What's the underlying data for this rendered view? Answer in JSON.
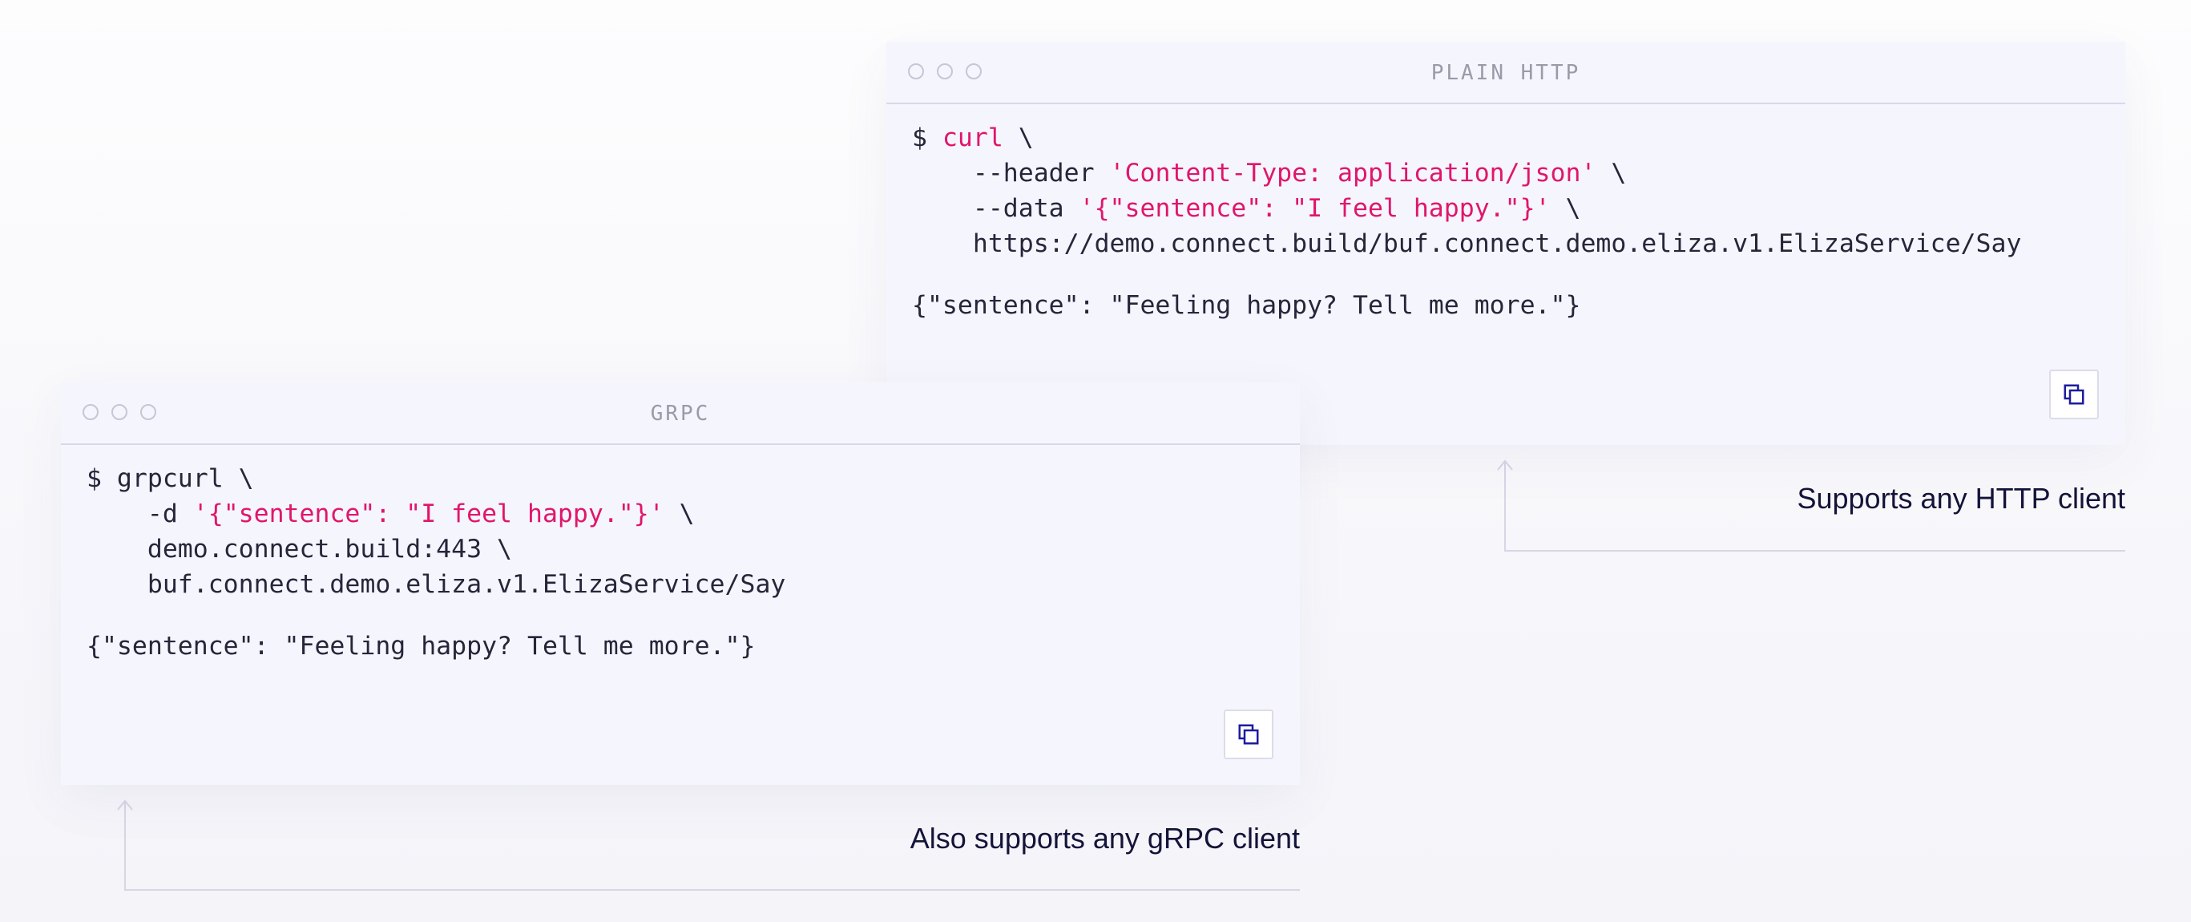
{
  "colors": {
    "background": "#f8f8fb",
    "card_background": "#f5f5fd",
    "code_text": "#26263a",
    "string_highlight": "#e0166b",
    "title_text": "#9a9aa8",
    "copy_icon": "#1c1c9e",
    "caption_text": "#14143a"
  },
  "http_card": {
    "title": "PLAIN HTTP",
    "command_lines": [
      {
        "prompt": "$ ",
        "cmd": "curl",
        "rest": " \\"
      },
      {
        "plain": "    --header ",
        "str": "'Content-Type: application/json'",
        "tail": " \\"
      },
      {
        "plain": "    --data ",
        "str": "'{\"sentence\": \"I feel happy.\"}'",
        "tail": " \\"
      },
      {
        "plain": "    https://demo.connect.build/buf.connect.demo.eliza.v1.ElizaService/Say"
      }
    ],
    "output": "{\"sentence\": \"Feeling happy? Tell me more.\"}",
    "copy_icon": "copy-icon"
  },
  "grpc_card": {
    "title": "GRPC",
    "command_lines": [
      {
        "plain": "$ grpcurl \\"
      },
      {
        "plain": "    -d ",
        "str": "'{\"sentence\": \"I feel happy.\"}'",
        "tail": " \\"
      },
      {
        "plain": "    demo.connect.build:443 \\"
      },
      {
        "plain": "    buf.connect.demo.eliza.v1.ElizaService/Say"
      }
    ],
    "output": "{\"sentence\": \"Feeling happy? Tell me more.\"}",
    "copy_icon": "copy-icon"
  },
  "annotations": {
    "http": "Supports any HTTP client",
    "grpc": "Also supports any gRPC client"
  }
}
